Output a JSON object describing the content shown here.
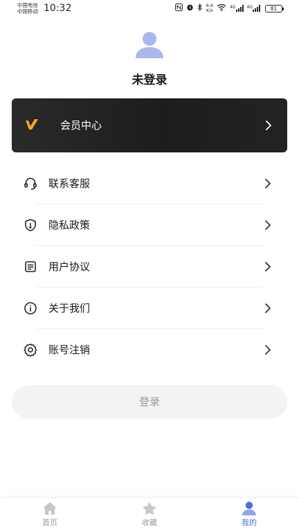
{
  "status_bar": {
    "carrier_1": "中国电信",
    "carrier_2": "中国移动",
    "time": "10:32",
    "net_speed_value": "6.6",
    "net_speed_unit": "K/s",
    "signal_1_label": "4G",
    "signal_2_label": "4G",
    "battery_level": "81"
  },
  "profile": {
    "login_status": "未登录"
  },
  "vip_card": {
    "label": "会员中心",
    "accent_color": "#f5a623"
  },
  "menu": {
    "items": [
      {
        "label": "联系客服",
        "icon": "headset-icon"
      },
      {
        "label": "隐私政策",
        "icon": "shield-icon"
      },
      {
        "label": "用户协议",
        "icon": "document-icon"
      },
      {
        "label": "关于我们",
        "icon": "info-icon"
      },
      {
        "label": "账号注销",
        "icon": "gear-icon"
      }
    ]
  },
  "login_button": {
    "label": "登录"
  },
  "tab_bar": {
    "tabs": [
      {
        "label": "首页",
        "icon": "home-icon",
        "active": false
      },
      {
        "label": "收藏",
        "icon": "star-icon",
        "active": false
      },
      {
        "label": "我的",
        "icon": "user-icon",
        "active": true
      }
    ],
    "active_color": "#4e6fd9",
    "inactive_color": "#c7c7c7"
  }
}
